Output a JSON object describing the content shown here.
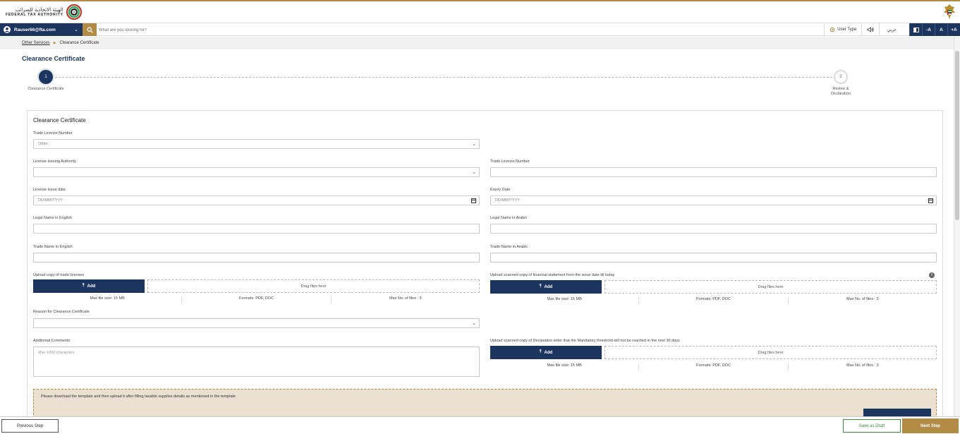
{
  "header": {
    "logo_ar": "الهيئة الاتحادية للضرائب",
    "logo_en": "FEDERAL TAX AUTHORITY"
  },
  "navbar": {
    "username": "Rauser66@fta.com",
    "search_placeholder": "What are you looking for?",
    "user_type": "User Type",
    "arabic": "عربي",
    "font_decrease": "-A",
    "font_normal": "A",
    "font_increase": "+A"
  },
  "breadcrumb": {
    "parent": "Other Services",
    "current": "Clearance Certificate"
  },
  "page_title": "Clearance Certificate",
  "stepper": {
    "steps": [
      {
        "number": "1",
        "label": "Clearance Certificate"
      },
      {
        "number": "2",
        "label_line1": "Review &",
        "label_line2": "Declaration"
      }
    ]
  },
  "form": {
    "title": "Clearance Certificate",
    "trade_license_number_label": "Trade License Number",
    "trade_license_number_value": "Other",
    "license_issuing_authority_label": "License Issuing Authority",
    "trade_license_number2_label": "Trade License Number",
    "license_issue_date_label": "License Issue date",
    "license_issue_date_placeholder": "DD/MM/YYYY",
    "expiry_date_label": "Expiry Date",
    "expiry_date_placeholder": "DD/MM/YYYY",
    "legal_name_en_label": "Legal Name in English",
    "legal_name_ar_label": "Legal Name in Arabic",
    "trade_name_en_label": "Trade Name in English",
    "trade_name_ar_label": "Trade Name in Arabic",
    "upload_trade_license_label": "Upload copy of trade licenses",
    "upload_financial_label": "Upload scanned copy of financial statement from the issue date till today",
    "reason_label": "Reason for Clearance Certificate",
    "additional_comments_label": "Additional Comments",
    "additional_comments_placeholder": "Max 1000 characters",
    "upload_declaration_label": "Upload scanned copy of Declaration letter that the Mandatory threshold will not be reached in the next 30 days",
    "add_label": "Add",
    "drag_label": "Drag files here",
    "max_size": "Max file size: 15 MB",
    "formats": "Formats: PDF, DOC",
    "max_files": "Max No. of files : 3"
  },
  "notice": {
    "text": "Please download the template and then upload it after filling taxable supplies details as mentioned in the template"
  },
  "footer": {
    "previous": "Previous Step",
    "save_draft": "Save as Draft",
    "next": "Next Step"
  },
  "colors": {
    "navy": "#1c355e",
    "gold": "#b28c45",
    "green": "#3d8b3d"
  }
}
